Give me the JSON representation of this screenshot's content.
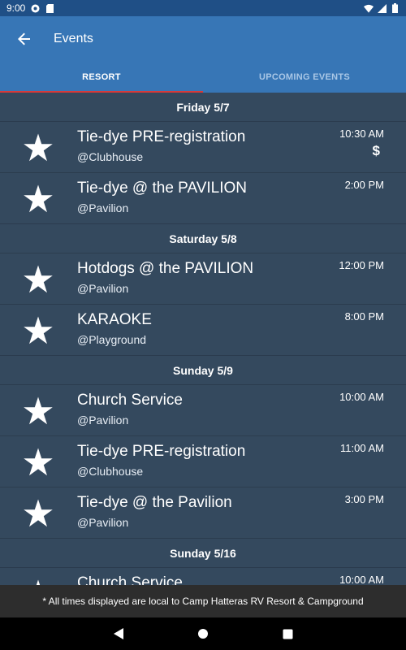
{
  "status_bar": {
    "time": "9:00"
  },
  "app_bar": {
    "title": "Events"
  },
  "tabs": [
    {
      "label": "RESORT",
      "active": true
    },
    {
      "label": "UPCOMING EVENTS",
      "active": false
    }
  ],
  "days": [
    {
      "label": "Friday 5/7",
      "events": [
        {
          "title": "Tie-dye PRE-registration",
          "location": "@Clubhouse",
          "time": "10:30 AM",
          "price": "$"
        },
        {
          "title": "Tie-dye @ the PAVILION",
          "location": "@Pavilion",
          "time": "2:00 PM"
        }
      ]
    },
    {
      "label": "Saturday 5/8",
      "events": [
        {
          "title": "Hotdogs @ the PAVILION",
          "location": "@Pavilion",
          "time": "12:00 PM"
        },
        {
          "title": "KARAOKE",
          "location": "@Playground",
          "time": "8:00 PM"
        }
      ]
    },
    {
      "label": "Sunday 5/9",
      "events": [
        {
          "title": "Church Service",
          "location": "@Pavilion",
          "time": "10:00 AM"
        },
        {
          "title": "Tie-dye PRE-registration",
          "location": "@Clubhouse",
          "time": "11:00 AM"
        },
        {
          "title": "Tie-dye @ the Pavilion",
          "location": "@Pavilion",
          "time": "3:00 PM"
        }
      ]
    },
    {
      "label": "Sunday 5/16",
      "events": [
        {
          "title": "Church Service",
          "location": "",
          "time": "10:00 AM"
        }
      ]
    }
  ],
  "footer": {
    "note": "* All times displayed are local to Camp Hatteras RV Resort & Campground"
  },
  "colors": {
    "app_bar": "#3776b6",
    "list_bg": "#34495e",
    "tab_indicator": "#d63a3a"
  },
  "icons": {
    "back": "arrow-left-icon",
    "favorite": "star-icon"
  }
}
